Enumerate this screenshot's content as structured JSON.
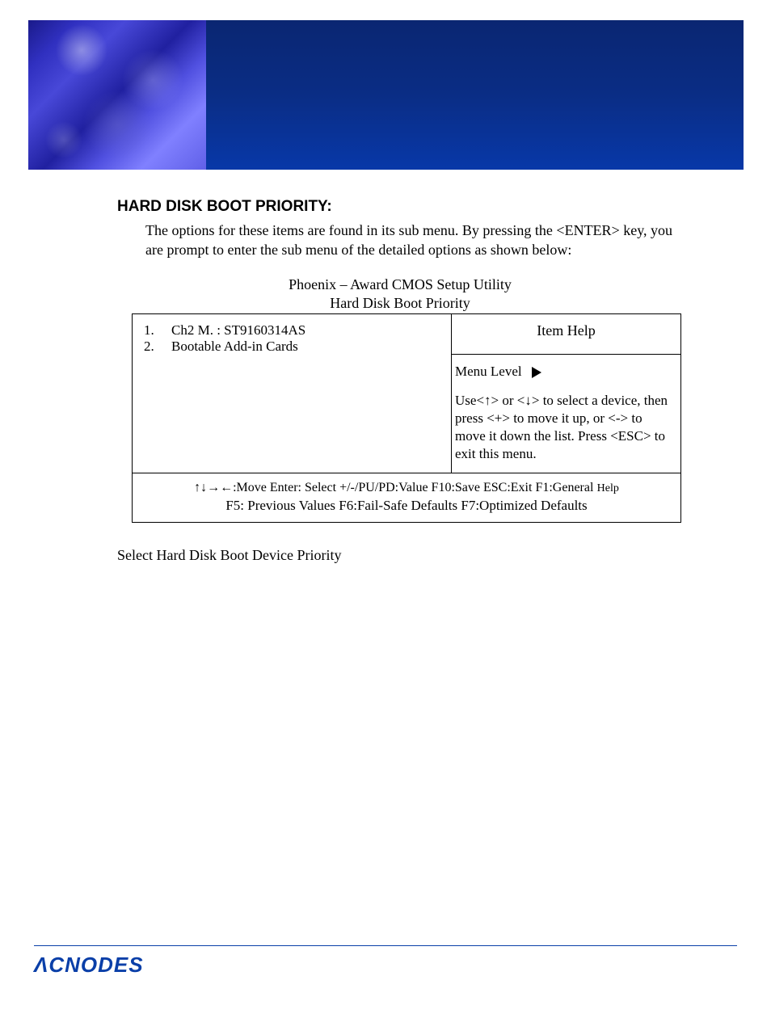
{
  "section": {
    "title": "HARD DISK BOOT PRIORITY:",
    "description": "The options for these items are found in its sub menu. By pressing the <ENTER> key, you are prompt to enter the sub menu of the detailed options as shown below:"
  },
  "bios": {
    "title": "Phoenix – Award CMOS Setup Utility",
    "subtitle": "Hard Disk Boot Priority",
    "devices": [
      {
        "num": "1.",
        "label": "Ch2 M.   :   ST9160314AS"
      },
      {
        "num": "2.",
        "label": "Bootable Add-in Cards"
      }
    ],
    "help_header": "Item Help",
    "menu_level_label": "Menu Level",
    "help_text": "Use<↑> or <↓> to select a device, then press <+> to move it up, or <-> to move it down the list. Press <ESC> to exit this menu.",
    "footer_line1_a": "↑↓→←:Move   Enter: Select   +/-/PU/PD:Value   F10:Save   ESC:Exit   F1:General",
    "footer_line1_b": "Help",
    "footer_line2": "F5: Previous Values       F6:Fail-Safe Defaults     F7:Optimized Defaults"
  },
  "post_note": "Select Hard Disk Boot Device Priority",
  "footer": {
    "logo": "ΛCNODES"
  }
}
